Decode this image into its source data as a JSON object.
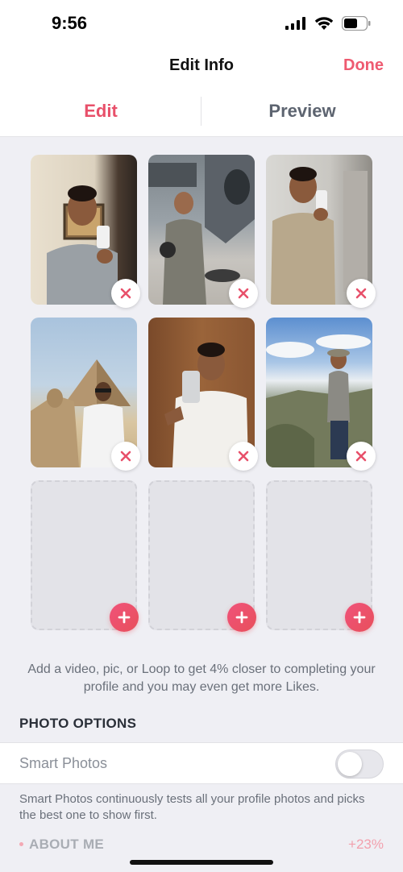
{
  "status_bar": {
    "time": "9:56"
  },
  "nav": {
    "title": "Edit Info",
    "done_label": "Done"
  },
  "tabs": [
    {
      "label": "Edit",
      "active": true
    },
    {
      "label": "Preview",
      "active": false
    }
  ],
  "photos": [
    {
      "name": "photo-1",
      "filled": true
    },
    {
      "name": "photo-2",
      "filled": true
    },
    {
      "name": "photo-3",
      "filled": true
    },
    {
      "name": "photo-4",
      "filled": true
    },
    {
      "name": "photo-5",
      "filled": true
    },
    {
      "name": "photo-6",
      "filled": true
    },
    {
      "name": "photo-slot-7",
      "filled": false
    },
    {
      "name": "photo-slot-8",
      "filled": false
    },
    {
      "name": "photo-slot-9",
      "filled": false
    }
  ],
  "hint": "Add a video, pic, or Loop to get 4% closer to completing your profile and you may even get more Likes.",
  "photo_options": {
    "title": "PHOTO OPTIONS",
    "smart_photos_label": "Smart Photos",
    "smart_photos_enabled": false,
    "smart_photos_description": "Smart Photos continuously tests all your profile photos and picks the best one to show first."
  },
  "about_me": {
    "label": "ABOUT ME",
    "boost": "+23%"
  },
  "colors": {
    "accent": "#ee5a70",
    "background": "#efeff4"
  }
}
